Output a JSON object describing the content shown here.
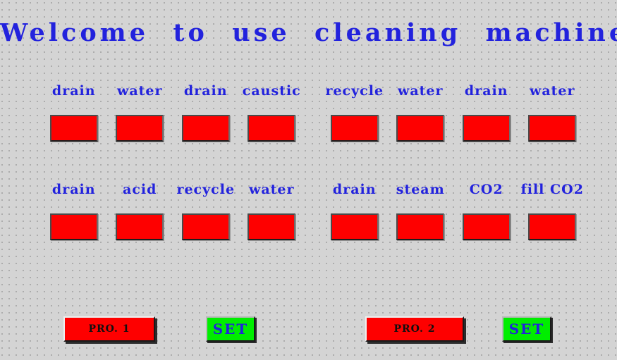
{
  "screen": {
    "title": "Welcome  to  use  cleaning  machine",
    "background_color": "#d4d4d4",
    "grid_dot_color": "#a9a9a9",
    "text_color": "#2222dd",
    "lamp_on_color": "#fe0000",
    "set_button_color": "#00ee00"
  },
  "step_rows": [
    {
      "row_id": "row-1",
      "steps": [
        {
          "label": "drain",
          "indicator": "lamp",
          "state_color": "#fe0000"
        },
        {
          "label": "water",
          "indicator": "lamp",
          "state_color": "#fe0000"
        },
        {
          "label": "drain",
          "indicator": "lamp",
          "state_color": "#fe0000"
        },
        {
          "label": "caustic",
          "indicator": "lamp",
          "state_color": "#fe0000"
        },
        {
          "label": "recycle",
          "indicator": "lamp",
          "state_color": "#fe0000"
        },
        {
          "label": "water",
          "indicator": "lamp",
          "state_color": "#fe0000"
        },
        {
          "label": "drain",
          "indicator": "lamp",
          "state_color": "#fe0000"
        },
        {
          "label": "water",
          "indicator": "lamp",
          "state_color": "#fe0000"
        }
      ]
    },
    {
      "row_id": "row-2",
      "steps": [
        {
          "label": "drain",
          "indicator": "lamp",
          "state_color": "#fe0000"
        },
        {
          "label": "acid",
          "indicator": "lamp",
          "state_color": "#fe0000"
        },
        {
          "label": "recycle",
          "indicator": "lamp",
          "state_color": "#fe0000"
        },
        {
          "label": "water",
          "indicator": "lamp",
          "state_color": "#fe0000"
        },
        {
          "label": "drain",
          "indicator": "lamp",
          "state_color": "#fe0000"
        },
        {
          "label": "steam",
          "indicator": "lamp",
          "state_color": "#fe0000"
        },
        {
          "label": "CO2",
          "indicator": "lamp",
          "state_color": "#fe0000"
        },
        {
          "label": "fill CO2",
          "indicator": "lamp",
          "state_color": "#fe0000"
        }
      ]
    }
  ],
  "buttons": {
    "program_1": "PRO. 1",
    "set_1": "SET",
    "program_2": "PRO. 2",
    "set_2": "SET"
  }
}
